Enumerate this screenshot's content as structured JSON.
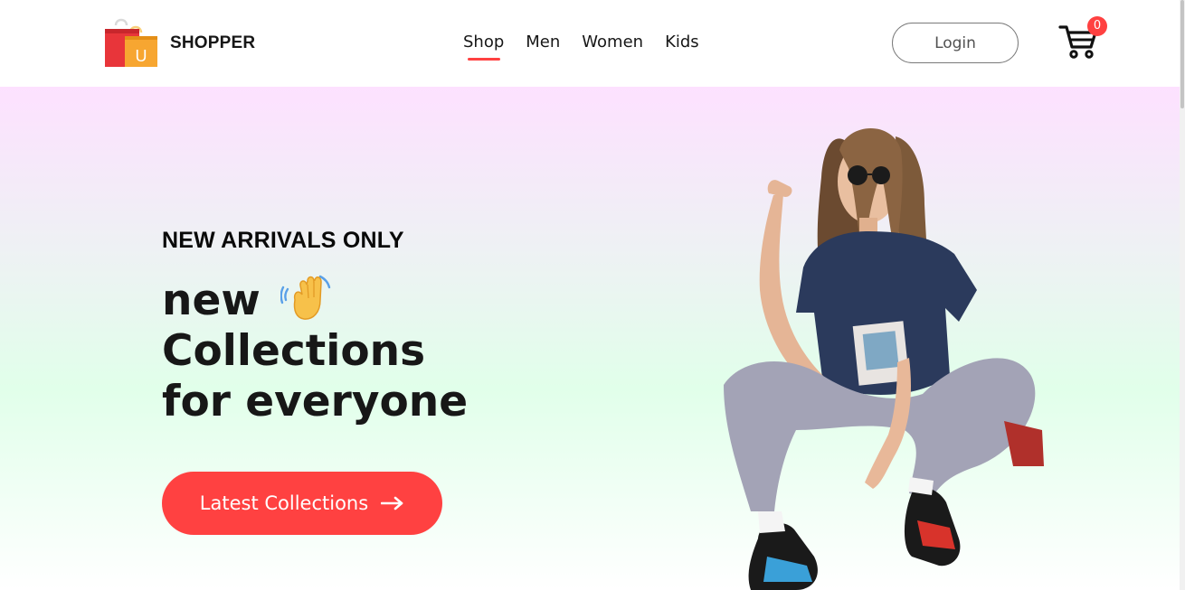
{
  "brand": {
    "name": "SHOPPER",
    "logo_icon": "shopping-bag-icon",
    "bag_letter": "U",
    "colors": {
      "bag_red": "#e8353a",
      "bag_orange": "#f7a631"
    }
  },
  "nav": {
    "items": [
      {
        "label": "Shop",
        "active": true
      },
      {
        "label": "Men",
        "active": false
      },
      {
        "label": "Women",
        "active": false
      },
      {
        "label": "Kids",
        "active": false
      }
    ],
    "login_label": "Login",
    "cart_icon": "cart-icon",
    "cart_count": "0"
  },
  "hero": {
    "eyebrow": "NEW ARRIVALS ONLY",
    "title_lines": [
      "new",
      "Collections",
      "for everyone"
    ],
    "hand_icon": "waving-hand-icon",
    "button_label": "Latest Collections",
    "button_icon": "arrow-right-icon",
    "image": "model-photo"
  },
  "colors": {
    "accent": "#ff4141",
    "gradient_top": "#fde1ff",
    "gradient_bottom": "#e1ffea",
    "text": "#171717"
  }
}
